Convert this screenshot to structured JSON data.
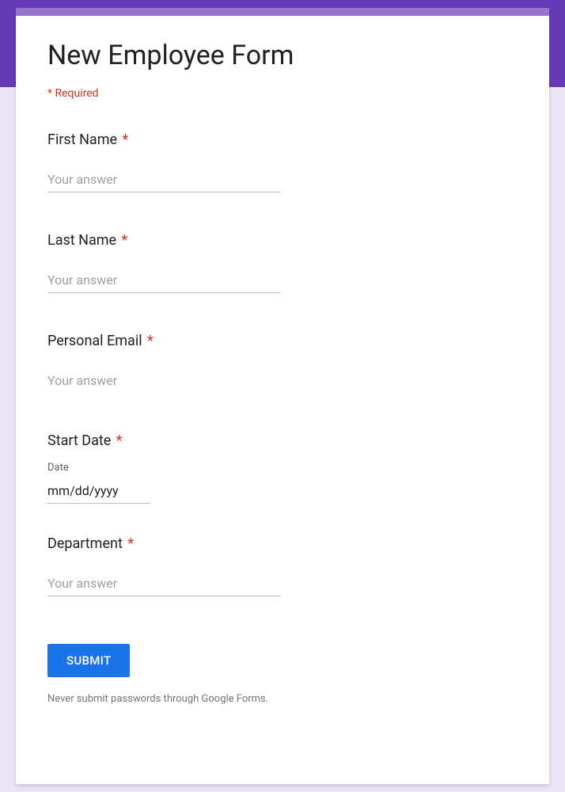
{
  "form": {
    "title": "New Employee Form",
    "required_note": "* Required",
    "submit_label": "SUBMIT",
    "footer_warning": "Never submit passwords through Google Forms."
  },
  "fields": {
    "first_name": {
      "label": "First Name",
      "placeholder": "Your answer",
      "required": true
    },
    "last_name": {
      "label": "Last Name",
      "placeholder": "Your answer",
      "required": true
    },
    "personal_email": {
      "label": "Personal Email",
      "placeholder": "Your answer",
      "required": true
    },
    "start_date": {
      "label": "Start Date",
      "sublabel": "Date",
      "value": "mm/dd/yyyy",
      "required": true
    },
    "department": {
      "label": "Department",
      "placeholder": "Your answer",
      "required": true
    }
  }
}
